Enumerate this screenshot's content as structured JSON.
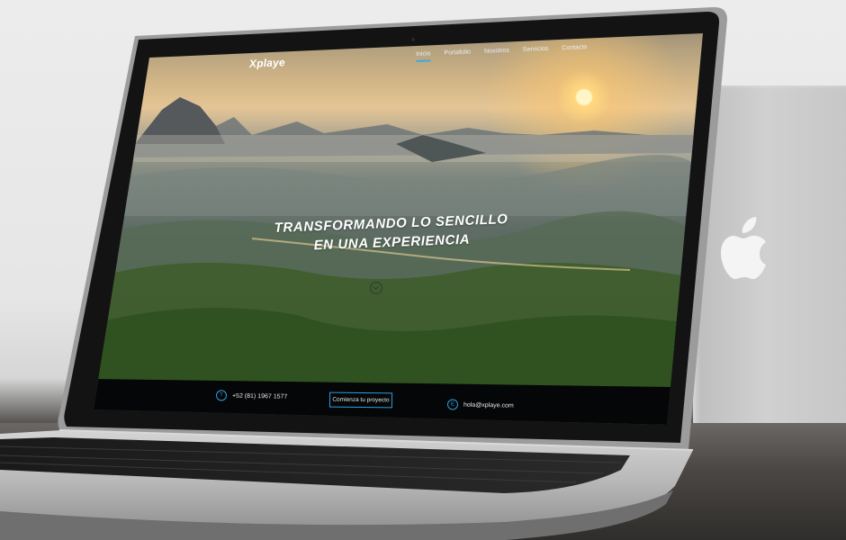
{
  "site": {
    "logo": "Xplaye",
    "nav": [
      {
        "label": "Inicio",
        "active": true
      },
      {
        "label": "Portafolio",
        "active": false
      },
      {
        "label": "Nosotros",
        "active": false
      },
      {
        "label": "Servicios",
        "active": false
      },
      {
        "label": "Contacto",
        "active": false
      }
    ],
    "hero": {
      "line1": "TRANSFORMANDO LO SENCILLO",
      "line2": "EN UNA EXPERIENCIA"
    },
    "footer": {
      "phone_icon_letter": "T",
      "phone": "+52 (81) 1967 1577",
      "cta": "Comienza tu proyecto",
      "email_icon_letter": "E",
      "email": "hola@xplaye.com"
    }
  },
  "colors": {
    "accent": "#2f9fe0",
    "footer_bg": "#050607",
    "bezel": "#141414"
  },
  "icons": {
    "scroll": "chevron-down-icon",
    "phone": "phone-icon",
    "email": "email-icon",
    "brand": "apple-logo-icon"
  }
}
